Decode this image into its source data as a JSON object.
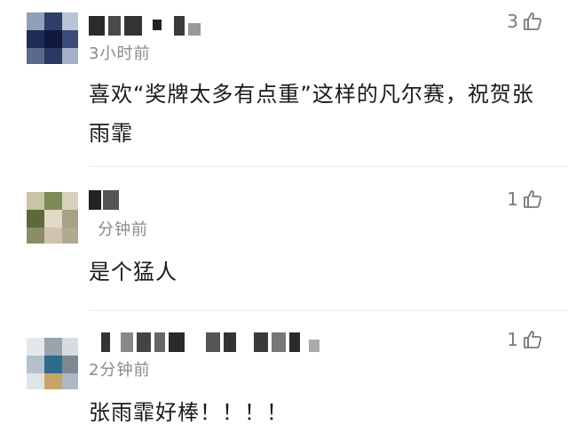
{
  "comments": [
    {
      "time": "3小时前",
      "likes": "3",
      "text": "喜欢“奖牌太多有点重”这样的凡尔赛，祝贺张雨霏"
    },
    {
      "time": "分钟前",
      "likes": "1",
      "text": "是个猛人"
    },
    {
      "time": "2分钟前",
      "likes": "1",
      "text": "张雨霏好棒！！！！"
    }
  ],
  "icons": {
    "like": "thumbs-up-icon"
  },
  "colors": {
    "text": "#1a1a1a",
    "meta": "#8a8a8a",
    "divider": "#ececec"
  }
}
